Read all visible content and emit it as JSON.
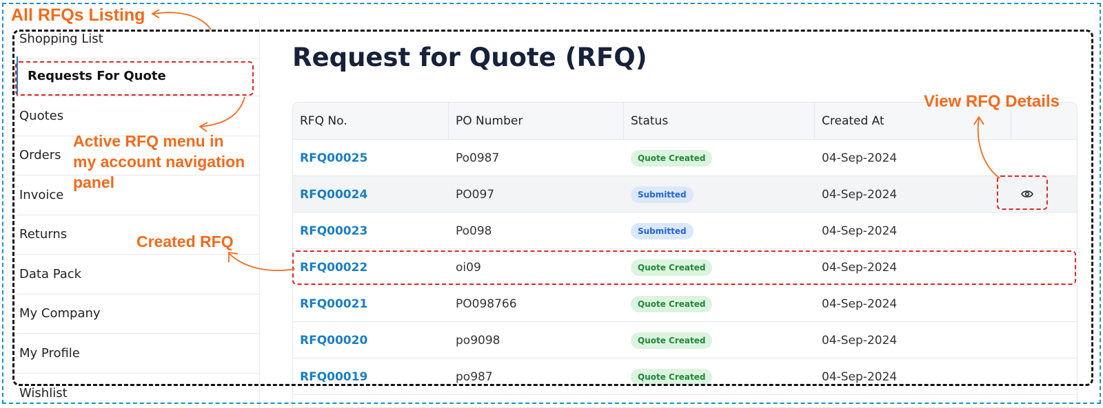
{
  "annotations": {
    "all_rfqs": "All RFQs Listing",
    "active_menu_line1": "Active RFQ menu in",
    "active_menu_line2": "my account navigation",
    "active_menu_line3": "panel",
    "created_rfq": "Created RFQ",
    "view_details": "View RFQ Details"
  },
  "sidebar": {
    "items": [
      {
        "label": "Shopping List"
      },
      {
        "label": "Requests For Quote",
        "active": true
      },
      {
        "label": "Quotes"
      },
      {
        "label": "Orders"
      },
      {
        "label": "Invoice"
      },
      {
        "label": "Returns"
      },
      {
        "label": "Data Pack"
      },
      {
        "label": "My Company"
      },
      {
        "label": "My Profile"
      },
      {
        "label": "Wishlist"
      }
    ]
  },
  "main": {
    "title": "Request for Quote (RFQ)",
    "columns": [
      "RFQ No.",
      "PO Number",
      "Status",
      "Created At",
      ""
    ],
    "rows": [
      {
        "rfq": "RFQ00025",
        "po": "Po0987",
        "status": "Quote Created",
        "created": "04-Sep-2024"
      },
      {
        "rfq": "RFQ00024",
        "po": "PO097",
        "status": "Submitted",
        "created": "04-Sep-2024"
      },
      {
        "rfq": "RFQ00023",
        "po": "Po098",
        "status": "Submitted",
        "created": "04-Sep-2024"
      },
      {
        "rfq": "RFQ00022",
        "po": "oi09",
        "status": "Quote Created",
        "created": "04-Sep-2024"
      },
      {
        "rfq": "RFQ00021",
        "po": "PO098766",
        "status": "Quote Created",
        "created": "04-Sep-2024"
      },
      {
        "rfq": "RFQ00020",
        "po": "po9098",
        "status": "Quote Created",
        "created": "04-Sep-2024"
      },
      {
        "rfq": "RFQ00019",
        "po": "po987",
        "status": "Quote Created",
        "created": "04-Sep-2024"
      }
    ],
    "view_icon": "eye-icon"
  },
  "colors": {
    "annotation": "#f26a1b",
    "highlight_box": "#e02424",
    "outer_frame": "#1b8fc7",
    "link": "#1a7fc1",
    "quote_created_bg": "#dcf3df",
    "submitted_bg": "#dbe7fb"
  }
}
